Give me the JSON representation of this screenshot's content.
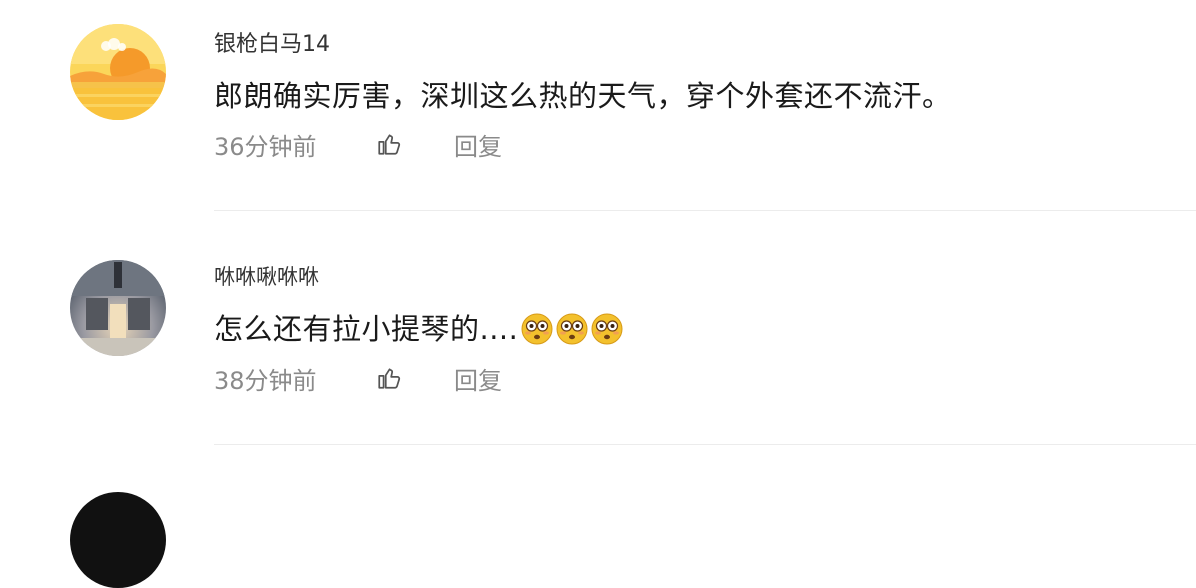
{
  "comments": [
    {
      "username": "银枪白马14",
      "text": "郎朗确实厉害，深圳这么热的天气，穿个外套还不流汗。",
      "time": "36分钟前",
      "reply_label": "回复"
    },
    {
      "username": "咻咻啾咻咻",
      "text": "怎么还有拉小提琴的....",
      "emojis": [
        "flushed-face-emoji",
        "flushed-face-emoji",
        "flushed-face-emoji"
      ],
      "time": "38分钟前",
      "reply_label": "回复"
    }
  ],
  "icons": {
    "like": "thumbs-up-outline-icon"
  },
  "colors": {
    "meta_text": "#8a8a8a",
    "divider": "#ececec",
    "sun_avatar": "#f5b82a",
    "emoji_face": "#f3c12d"
  }
}
